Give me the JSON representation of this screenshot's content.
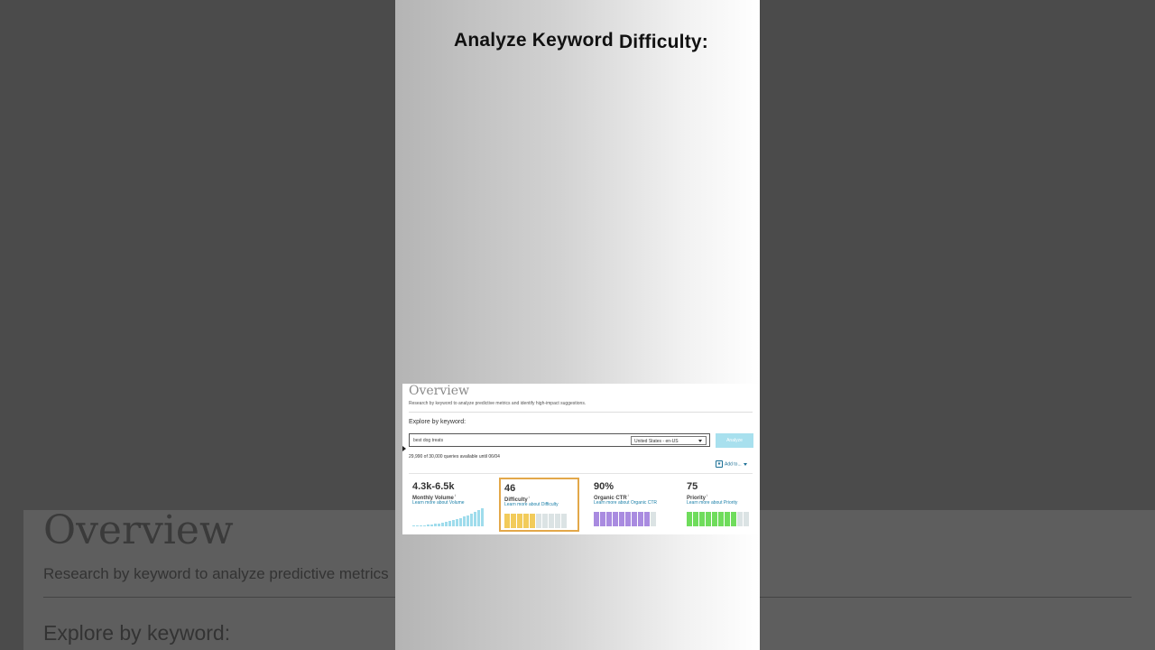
{
  "headline": {
    "word1": "Analyze Keyword",
    "word2": "Difficulty:"
  },
  "overview": {
    "title": "Overview",
    "description": "Research by keyword to analyze predictive metrics and identify high-impact suggestions.",
    "explore_label": "Explore by keyword:",
    "search_value": "best dog treats",
    "locale": "United States - en-US",
    "analyze_label": "Analyze",
    "queries_text": "29,990 of 30,000 queries available until 06/04",
    "add_to_label": "Add to..."
  },
  "metrics": [
    {
      "value": "4.3k-6.5k",
      "name": "Monthly Volume",
      "link": "Learn more about Volume"
    },
    {
      "value": "46",
      "name": "Difficulty",
      "link": "Learn more about Difficulty",
      "fill": 0.46,
      "color": "#f2cb5a"
    },
    {
      "value": "90%",
      "name": "Organic CTR",
      "link": "Learn more about Organic CTR",
      "fill": 0.9,
      "color": "#a98be0"
    },
    {
      "value": "75",
      "name": "Priority",
      "link": "Learn more about Priority",
      "fill": 0.75,
      "color": "#6fdc5c"
    }
  ],
  "background": {
    "title": "Overview",
    "description": "Research by keyword to analyze predictive metrics",
    "explore_label": "Explore by keyword:"
  },
  "colors": {
    "selected_border": "#e3a84a",
    "link": "#1a7fa8",
    "analyze_button": "#a8e0ee",
    "empty_bar": "#dbe3e4"
  }
}
